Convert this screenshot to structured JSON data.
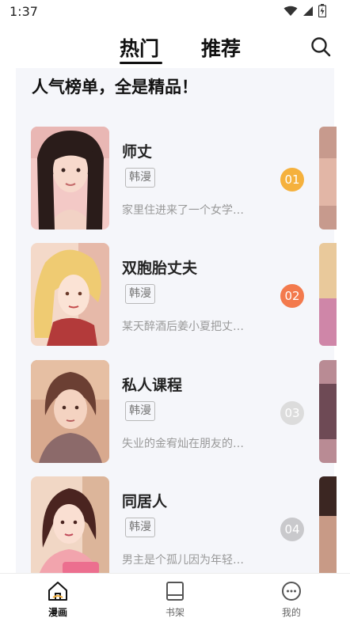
{
  "status_bar": {
    "time": "1:37"
  },
  "header": {
    "tabs": [
      {
        "label": "热门",
        "active": true
      },
      {
        "label": "推荐",
        "active": false
      }
    ],
    "search_icon": "search-icon"
  },
  "section": {
    "title": "人气榜单，全是精品！"
  },
  "items": [
    {
      "title": "师丈",
      "tag": "韩漫",
      "description": "家里住进来了一个女学…",
      "rank": "01",
      "rank_color": "#f5b13d"
    },
    {
      "title": "双胞胎丈夫",
      "tag": "韩漫",
      "description": "某天醉酒后姜小夏把丈…",
      "rank": "02",
      "rank_color": "#f37a4d"
    },
    {
      "title": "私人课程",
      "tag": "韩漫",
      "description": "失业的金宥灿在朋友的…",
      "rank": "03",
      "rank_color": "#dcdcdc"
    },
    {
      "title": "同居人",
      "tag": "韩漫",
      "description": "男主是个孤儿因为年轻…",
      "rank": "04",
      "rank_color": "#c9c9cc"
    }
  ],
  "bottom_nav": [
    {
      "label": "漫画",
      "icon": "home-icon",
      "active": true
    },
    {
      "label": "书架",
      "icon": "bookshelf-icon",
      "active": false
    },
    {
      "label": "我的",
      "icon": "profile-icon",
      "active": false
    }
  ]
}
